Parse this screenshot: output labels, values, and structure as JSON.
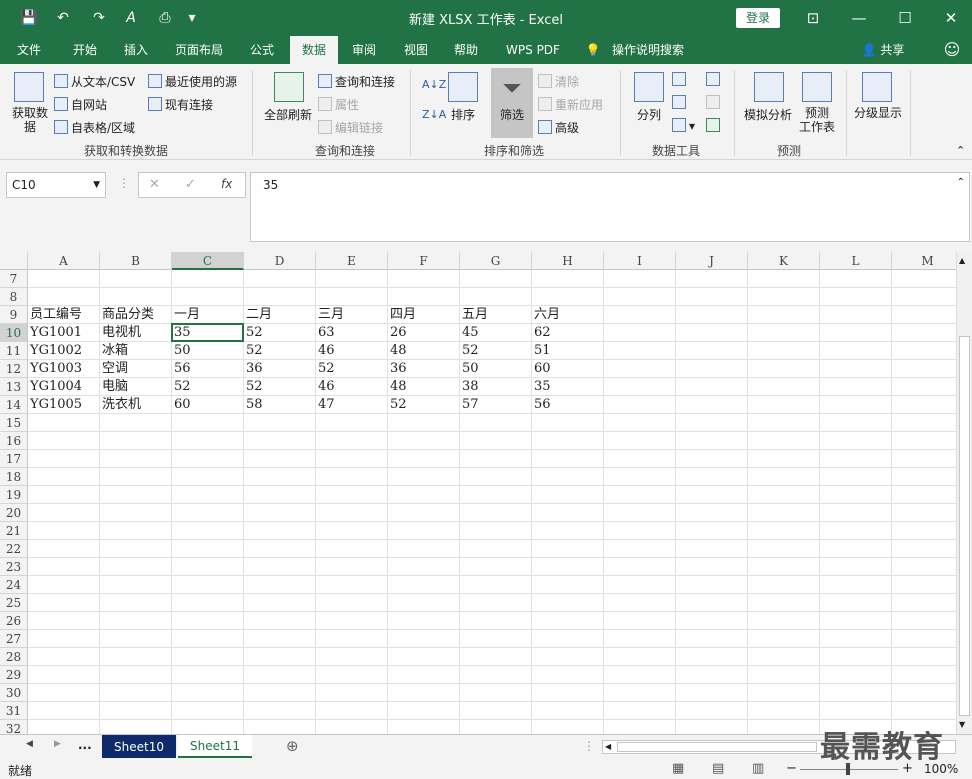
{
  "window": {
    "title": "新建 XLSX 工作表 - Excel",
    "login": "登录",
    "qat": {
      "save": "💾",
      "undo": "↶",
      "redo": "↷",
      "custom": "▾"
    }
  },
  "tabs": [
    "文件",
    "开始",
    "插入",
    "页面布局",
    "公式",
    "数据",
    "审阅",
    "视图",
    "帮助",
    "WPS PDF",
    "操作说明搜索"
  ],
  "share": "共享",
  "ribbon": {
    "get_data": {
      "big_label": "获取数\n据",
      "items": [
        "从文本/CSV",
        "自网站",
        "自表格/区域",
        "最近使用的源",
        "现有连接"
      ],
      "group_label": "获取和转换数据"
    },
    "queries": {
      "big_label": "全部刷新",
      "items": [
        "查询和连接",
        "属性",
        "编辑链接"
      ],
      "group_label": "查询和连接"
    },
    "sort_filter": {
      "sort": "排序",
      "filter": "筛选",
      "items": [
        "清除",
        "重新应用",
        "高级"
      ],
      "group_label": "排序和筛选"
    },
    "data_tools": {
      "split": "分列",
      "group_label": "数据工具"
    },
    "forecast": {
      "whatif": "模拟分析",
      "sheet": "预测\n工作表",
      "group_label": "预测"
    },
    "outline": {
      "label": "分级显示"
    }
  },
  "formula_bar": {
    "name_box": "C10",
    "fx": "fx",
    "formula": "35"
  },
  "grid": {
    "columns": [
      "A",
      "B",
      "C",
      "D",
      "E",
      "F",
      "G",
      "H",
      "I",
      "J",
      "K",
      "L",
      "M"
    ],
    "selected_column": "C",
    "rows": [
      "7",
      "8",
      "9",
      "10",
      "11",
      "12",
      "13",
      "14",
      "15",
      "16",
      "17",
      "18",
      "19",
      "20",
      "21",
      "22",
      "23",
      "24",
      "25",
      "26",
      "27",
      "28",
      "29",
      "30",
      "31",
      "32"
    ],
    "selected_row": "10",
    "data": [
      {
        "row": "9",
        "cells": [
          "员工编号",
          "商品分类",
          "一月",
          "二月",
          "三月",
          "四月",
          "五月",
          "六月"
        ]
      },
      {
        "row": "10",
        "cells": [
          "YG1001",
          "电视机",
          "35",
          "52",
          "63",
          "26",
          "45",
          "62"
        ]
      },
      {
        "row": "11",
        "cells": [
          "YG1002",
          "冰箱",
          "50",
          "52",
          "46",
          "48",
          "52",
          "51"
        ]
      },
      {
        "row": "12",
        "cells": [
          "YG1003",
          "空调",
          "56",
          "36",
          "52",
          "36",
          "50",
          "60"
        ]
      },
      {
        "row": "13",
        "cells": [
          "YG1004",
          "电脑",
          "52",
          "52",
          "46",
          "48",
          "38",
          "35"
        ]
      },
      {
        "row": "14",
        "cells": [
          "YG1005",
          "洗衣机",
          "60",
          "58",
          "47",
          "52",
          "57",
          "56"
        ]
      }
    ]
  },
  "sheets": {
    "tabs": [
      "Sheet10",
      "Sheet11"
    ],
    "active": "Sheet11",
    "more": "...",
    "add": "⊕"
  },
  "status": {
    "ready": "就绪",
    "zoom": "100%",
    "minus": "−",
    "plus": "+"
  },
  "watermark": "最需教育"
}
